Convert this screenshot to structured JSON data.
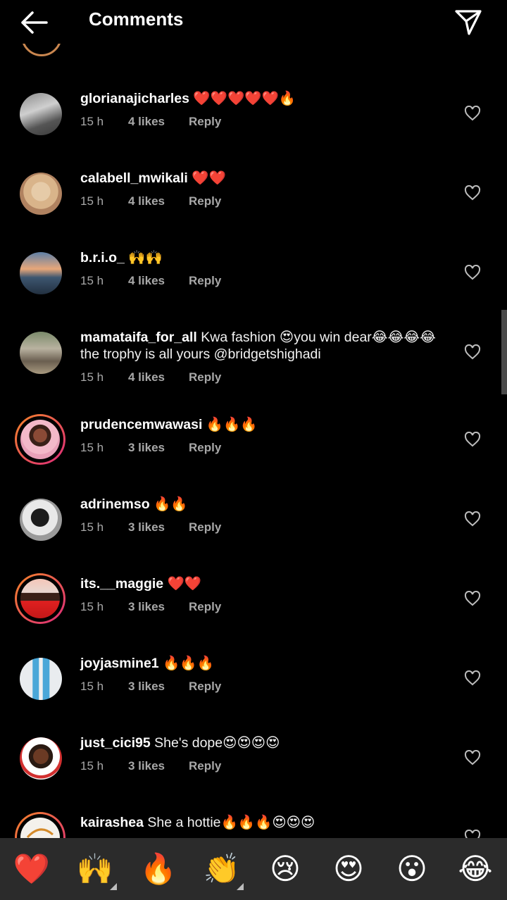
{
  "header": {
    "title": "Comments",
    "back_icon": "arrow-left-icon",
    "send_icon": "paper-plane-icon"
  },
  "comments": [
    {
      "username": "glorianajicharles",
      "text": " ❤️❤️❤️❤️❤️🔥",
      "time": "15 h",
      "likes": "4 likes",
      "reply": "Reply"
    },
    {
      "username": "calabell_mwikali",
      "text": " ❤️❤️",
      "time": "15 h",
      "likes": "4 likes",
      "reply": "Reply"
    },
    {
      "username": "b.r.i.o_",
      "text": " 🙌🙌",
      "time": "15 h",
      "likes": "4 likes",
      "reply": "Reply"
    },
    {
      "username": "mamataifa_for_all",
      "text": " Kwa  fashion 😍you win dear😂😂😂😂 the trophy is all yours @bridgetshighadi",
      "time": "15 h",
      "likes": "4 likes",
      "reply": "Reply"
    },
    {
      "username": "prudencemwawasi",
      "text": " 🔥🔥🔥",
      "time": "15 h",
      "likes": "3 likes",
      "reply": "Reply"
    },
    {
      "username": "adrinemso",
      "text": " 🔥🔥",
      "time": "15 h",
      "likes": "3 likes",
      "reply": "Reply"
    },
    {
      "username": "its.__maggie",
      "text": " ❤️❤️",
      "time": "15 h",
      "likes": "3 likes",
      "reply": "Reply"
    },
    {
      "username": "joyjasmine1",
      "text": " 🔥🔥🔥",
      "time": "15 h",
      "likes": "3 likes",
      "reply": "Reply"
    },
    {
      "username": "just_cici95",
      "text": " She's dope😍😍😍😍",
      "time": "15 h",
      "likes": "3 likes",
      "reply": "Reply"
    },
    {
      "username": "kairashea",
      "text": " She a hottie🔥🔥🔥😍😍😍",
      "time": "",
      "likes": "",
      "reply": ""
    }
  ],
  "emoji_bar": [
    "❤️",
    "🙌",
    "🔥",
    "👏",
    "😢",
    "😍",
    "😮",
    "😂"
  ],
  "colors": {
    "background": "#000000",
    "emoji_bar": "#2b2b2b",
    "meta_text": "#a8a8a8",
    "story_ring": "#dd2a7b"
  }
}
